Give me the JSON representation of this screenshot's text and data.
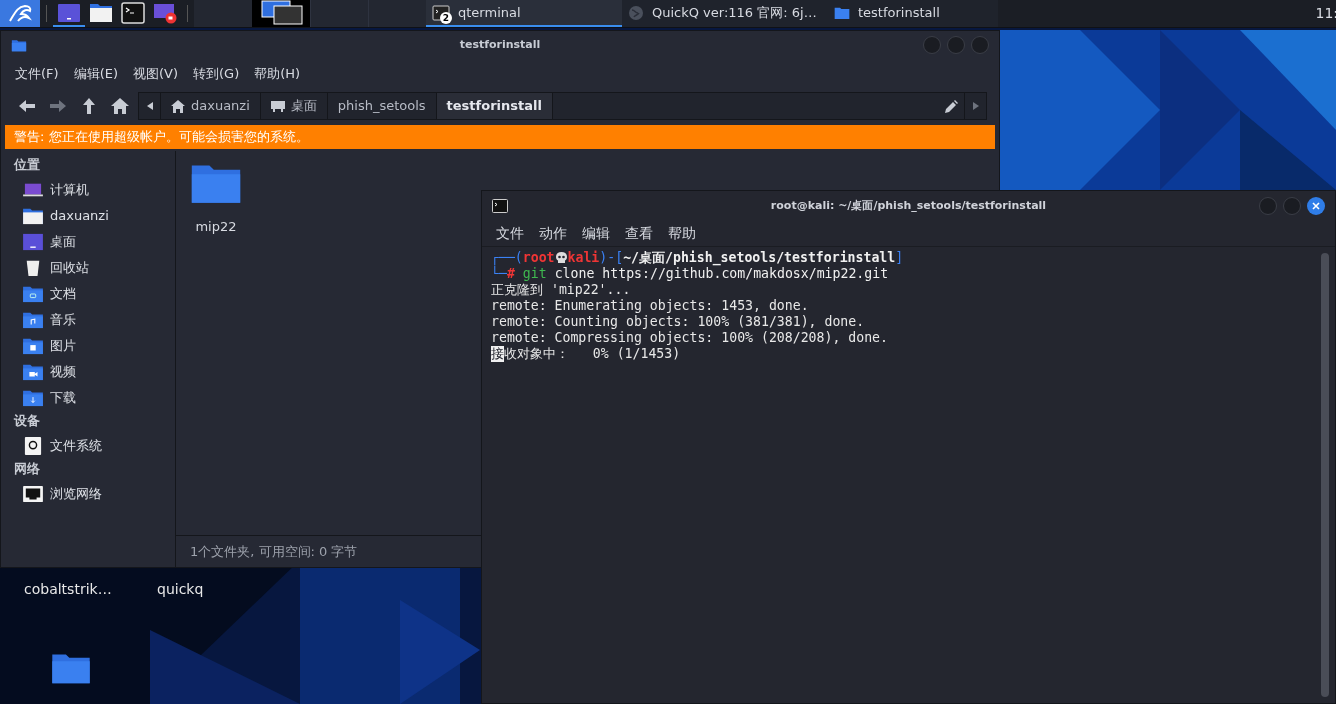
{
  "taskbar": {
    "launchers": [
      {
        "kind": "desktop",
        "selected": true
      },
      {
        "kind": "files",
        "selected": false
      },
      {
        "kind": "terminal",
        "selected": false
      },
      {
        "kind": "recorder",
        "selected": false
      }
    ],
    "tasks": [
      {
        "kind": "terminal",
        "title": "qterminal",
        "badge": "2",
        "selected": true
      },
      {
        "kind": "web",
        "title": "QuickQ ver:116 官网: 6j…",
        "selected": false
      },
      {
        "kind": "folder",
        "title": "testforinstall",
        "selected": false
      }
    ],
    "clock": "11:"
  },
  "desktop_icons": [
    {
      "label": "cobaltstrik…"
    },
    {
      "label": "quickq"
    },
    {
      "kind": "folder"
    }
  ],
  "file_manager": {
    "title": "testforinstall",
    "menu": [
      "文件(F)",
      "编辑(E)",
      "视图(V)",
      "转到(G)",
      "帮助(H)"
    ],
    "breadcrumb": [
      {
        "kind": "home",
        "label": "daxuanzi",
        "selected": false
      },
      {
        "kind": "desktop",
        "label": "桌面",
        "selected": false
      },
      {
        "kind": "plain",
        "label": "phish_setools",
        "selected": false
      },
      {
        "kind": "plain",
        "label": "testforinstall",
        "selected": true
      }
    ],
    "warning": "警告: 您正在使用超级帐户。可能会损害您的系统。",
    "sidebar": [
      {
        "title": "位置",
        "items": [
          {
            "kind": "computer",
            "label": "计算机"
          },
          {
            "kind": "home",
            "label": "daxuanzi"
          },
          {
            "kind": "desktop",
            "label": "桌面"
          },
          {
            "kind": "trash",
            "label": "回收站"
          },
          {
            "kind": "documents",
            "label": "文档"
          },
          {
            "kind": "music",
            "label": "音乐"
          },
          {
            "kind": "pictures",
            "label": "图片"
          },
          {
            "kind": "videos",
            "label": "视频"
          },
          {
            "kind": "downloads",
            "label": "下载"
          }
        ]
      },
      {
        "title": "设备",
        "items": [
          {
            "kind": "drive",
            "label": "文件系统"
          }
        ]
      },
      {
        "title": "网络",
        "items": [
          {
            "kind": "network",
            "label": "浏览网络"
          }
        ]
      }
    ],
    "files": [
      {
        "name": "mip22"
      }
    ],
    "status": "1个文件夹, 可用空间: 0 字节"
  },
  "terminal": {
    "title": "root@kali: ~/桌面/phish_setools/testforinstall",
    "menu": [
      "文件",
      "动作",
      "编辑",
      "查看",
      "帮助"
    ],
    "prompt": {
      "open": "┌──(",
      "user": "root",
      "host": "kali",
      "mid": ")-[",
      "path": "~/桌面/phish_setools/testforinstall",
      "close": "]",
      "corner": "└─",
      "hash": "#",
      "command": "git",
      "args": "clone https://github.com/makdosx/mip22.git"
    },
    "output": [
      "正克隆到 'mip22'...",
      "remote: Enumerating objects: 1453, done.",
      "remote: Counting objects: 100% (381/381), done.",
      "remote: Compressing objects: 100% (208/208), done."
    ],
    "cursor_char": "接",
    "last_line": "收对象中：   0% (1/1453)"
  }
}
